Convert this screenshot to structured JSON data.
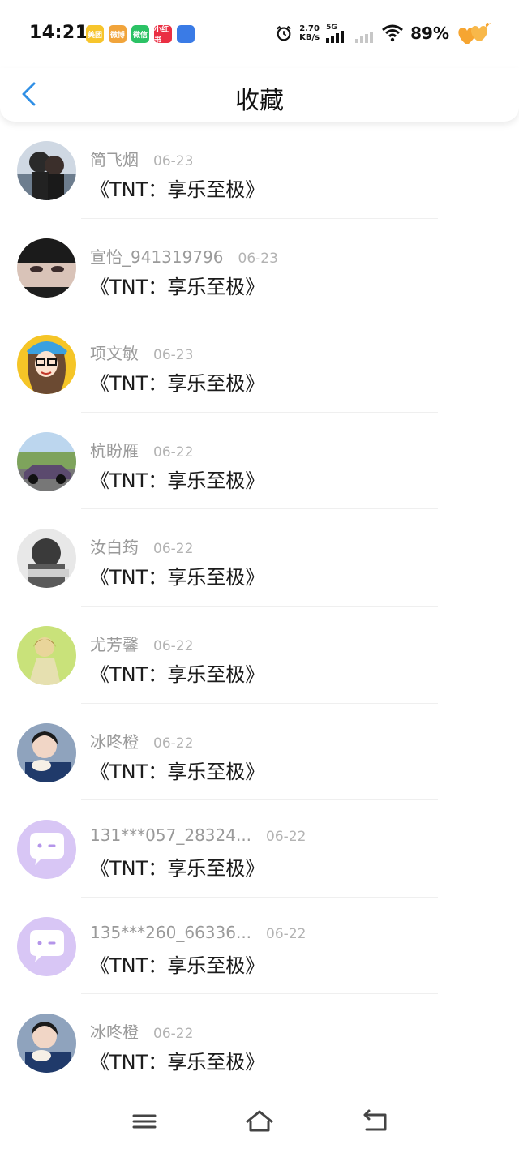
{
  "status_bar": {
    "time": "14:21",
    "notification_apps": [
      {
        "label": "美团",
        "color": "#f7c52c"
      },
      {
        "label": "微博",
        "color": "#f1a43b"
      },
      {
        "label": "微信",
        "color": "#2bc265"
      },
      {
        "label": "小红书",
        "color": "#ea2f43"
      },
      {
        "label": "",
        "color": "#3a7be6"
      }
    ],
    "net_speed_value": "2.70",
    "net_speed_unit": "KB/s",
    "network": "5G",
    "battery": "89%"
  },
  "header": {
    "title": "收藏"
  },
  "favorites": [
    {
      "user": "简飞烟",
      "date": "06-23",
      "content": "《TNT：享乐至极》",
      "avatar": "couple-photo"
    },
    {
      "user": "宣怡_941319796",
      "date": "06-23",
      "content": "《TNT：享乐至极》",
      "avatar": "face-photo"
    },
    {
      "user": "项文敏",
      "date": "06-23",
      "content": "《TNT：享乐至极》",
      "avatar": "cartoon-girl"
    },
    {
      "user": "杭盼雁",
      "date": "06-22",
      "content": "《TNT：享乐至极》",
      "avatar": "car-photo"
    },
    {
      "user": "汝白筠",
      "date": "06-22",
      "content": "《TNT：享乐至极》",
      "avatar": "bw-photo"
    },
    {
      "user": "尤芳馨",
      "date": "06-22",
      "content": "《TNT：享乐至极》",
      "avatar": "green-photo"
    },
    {
      "user": "冰咚橙",
      "date": "06-22",
      "content": "《TNT：享乐至极》",
      "avatar": "girl-eating"
    },
    {
      "user": "131***057_28324...",
      "date": "06-22",
      "content": "《TNT：享乐至极》",
      "avatar": "default-bubble"
    },
    {
      "user": "135***260_66336...",
      "date": "06-22",
      "content": "《TNT：享乐至极》",
      "avatar": "default-bubble"
    },
    {
      "user": "冰咚橙",
      "date": "06-22",
      "content": "《TNT：享乐至极》",
      "avatar": "girl-eating"
    }
  ],
  "colors": {
    "accent": "#2f8fe6",
    "name_gray": "#9a9a9a",
    "default_avatar": "#d8c6f5"
  }
}
